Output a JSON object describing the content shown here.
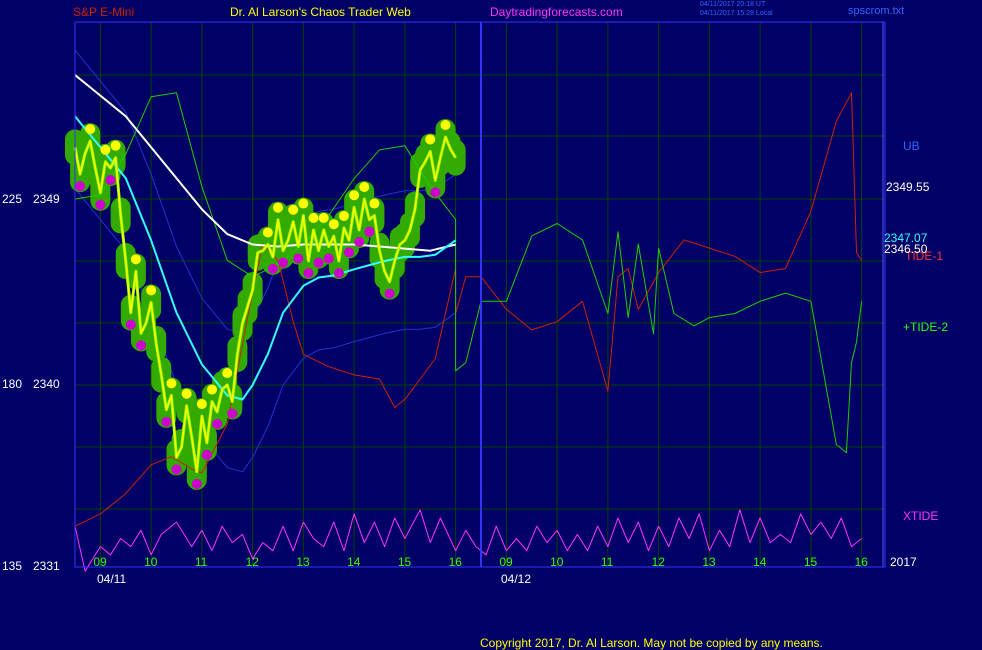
{
  "header": {
    "symbol": "S&P E-Mini",
    "site_title": "Dr. Al Larson's Chaos Trader Web",
    "site_url": "Daytradingforecasts.com",
    "timestamp_utc": "04/11/2017 20:18 UT",
    "timestamp_local": "04/11/2017 15:28 Local",
    "file": "spscrom.txt"
  },
  "footer": {
    "copyright": "Copyright 2017, Dr. Al Larson. May not be copied by any means."
  },
  "colors": {
    "background": "#000066",
    "grid": "#004400",
    "frame": "#3333ff",
    "price": "#ffff00",
    "average": "#ffffff",
    "cyan_average": "#33ffff",
    "bands": "#2233cc",
    "tide1": "#cc2200",
    "tide2": "#22cc00",
    "xtide": "#ff33ff",
    "blob": "#33aa00",
    "hit_high": "#ffff00",
    "hit_low": "#cc00cc"
  },
  "chart_data": {
    "type": "line",
    "title": "S&P E-Mini",
    "left_axis_ticks": [
      {
        "osc": "225",
        "price": "2349"
      },
      {
        "osc": "180",
        "price": "2340"
      },
      {
        "osc": "135",
        "price": "2331"
      }
    ],
    "x_hour_labels_day1": [
      "09",
      "10",
      "11",
      "12",
      "13",
      "14",
      "15",
      "16"
    ],
    "x_hour_labels_day2": [
      "09",
      "10",
      "11",
      "12",
      "13",
      "14",
      "15",
      "16"
    ],
    "dates": [
      "04/11",
      "04/12"
    ],
    "year": "2017",
    "price_ylim": [
      2331,
      2355
    ],
    "x_range_hours": [
      8.5,
      16.5
    ],
    "price_series": {
      "name": "S&P E-Mini",
      "x": [
        8.5,
        8.6,
        8.7,
        8.8,
        8.9,
        9.0,
        9.1,
        9.2,
        9.3,
        9.4,
        9.5,
        9.6,
        9.7,
        9.8,
        9.9,
        10.0,
        10.1,
        10.2,
        10.3,
        10.4,
        10.5,
        10.6,
        10.7,
        10.8,
        10.9,
        11.0,
        11.1,
        11.2,
        11.3,
        11.4,
        11.5,
        11.6,
        11.7,
        11.8,
        11.9,
        12.0,
        12.1,
        12.2,
        12.3,
        12.4,
        12.5,
        12.6,
        12.7,
        12.8,
        12.9,
        13.0,
        13.1,
        13.2,
        13.3,
        13.4,
        13.5,
        13.6,
        13.7,
        13.8,
        13.9,
        14.0,
        14.1,
        14.2,
        14.3,
        14.4,
        14.5,
        14.6,
        14.7,
        14.8,
        14.9,
        15.0,
        15.1,
        15.2,
        15.3,
        15.4,
        15.5,
        15.6,
        15.7,
        15.8,
        15.9,
        16.0
      ],
      "y": [
        2351.5,
        2350.2,
        2351.2,
        2351.8,
        2350.5,
        2349.3,
        2350.8,
        2350.5,
        2351.0,
        2348.2,
        2346.0,
        2343.5,
        2345.5,
        2342.5,
        2343.0,
        2344.0,
        2342.0,
        2340.5,
        2338.8,
        2339.5,
        2336.5,
        2337.0,
        2339.0,
        2337.5,
        2335.8,
        2338.5,
        2337.2,
        2339.2,
        2338.7,
        2339.8,
        2340.0,
        2339.2,
        2341.5,
        2343.0,
        2343.8,
        2344.6,
        2346.4,
        2346.5,
        2346.8,
        2346.2,
        2348.0,
        2346.5,
        2347.0,
        2347.9,
        2346.7,
        2348.2,
        2346.0,
        2347.5,
        2346.5,
        2347.5,
        2346.7,
        2347.2,
        2346.0,
        2347.6,
        2347.0,
        2348.6,
        2347.5,
        2349.0,
        2348.0,
        2348.2,
        2346.5,
        2345.5,
        2345.0,
        2346.0,
        2346.8,
        2347.0,
        2347.5,
        2348.5,
        2350.4,
        2350.8,
        2351.3,
        2349.9,
        2351.0,
        2352.0,
        2351.4,
        2351.0
      ]
    },
    "white_average": {
      "x": [
        8.5,
        9.0,
        9.5,
        10.0,
        10.5,
        11.0,
        11.5,
        12.0,
        12.5,
        13.0,
        13.5,
        14.0,
        14.5,
        15.0,
        15.5,
        16.0
      ],
      "y": [
        2355.0,
        2354.0,
        2353.0,
        2351.5,
        2350.0,
        2348.5,
        2347.3,
        2346.8,
        2346.7,
        2346.8,
        2346.8,
        2346.8,
        2346.7,
        2346.6,
        2346.5,
        2346.8
      ]
    },
    "cyan_average": {
      "x": [
        8.5,
        9.0,
        9.5,
        10.0,
        10.5,
        11.0,
        11.5,
        11.8,
        12.0,
        12.3,
        12.6,
        13.0,
        13.3,
        13.6,
        14.0,
        14.3,
        14.6,
        15.0,
        15.3,
        15.6,
        16.0
      ],
      "y": [
        2353.0,
        2351.5,
        2350.0,
        2347.0,
        2343.5,
        2341.0,
        2339.5,
        2339.3,
        2340.0,
        2341.5,
        2343.5,
        2344.8,
        2345.2,
        2345.3,
        2345.6,
        2345.8,
        2346.0,
        2346.2,
        2346.2,
        2346.3,
        2347.0
      ]
    },
    "tide_series": [
      {
        "name": "TIDE-1",
        "end_value": "2346.50",
        "x": [
          8.5,
          9.0,
          9.5,
          10.0,
          10.4,
          10.8,
          11.0,
          11.5,
          11.9,
          12.2,
          12.5,
          12.8,
          13.0,
          13.5,
          14.0,
          14.5,
          14.8,
          15.0,
          15.3,
          15.6,
          16.0,
          16.0,
          16.2,
          16.5,
          17.0,
          17.5,
          18.0,
          18.5,
          19.0,
          19.2,
          19.4,
          19.6,
          20.0,
          20.5,
          21.0,
          21.5,
          22.0,
          22.5,
          23.0,
          23.5,
          23.8,
          23.9,
          24.0
        ],
        "y": [
          145,
          148,
          153,
          160,
          162,
          159,
          158,
          170,
          196,
          214,
          210,
          195,
          187,
          184,
          182,
          181,
          174,
          176,
          181,
          186,
          208,
          197,
          206,
          206,
          198,
          193,
          195,
          200,
          178,
          206,
          208,
          198,
          207,
          215,
          213,
          211,
          207,
          208,
          222,
          244,
          251,
          212,
          210
        ]
      },
      {
        "name": "+TIDE-2",
        "end_value": "",
        "x": [
          8.5,
          9.0,
          9.5,
          10.0,
          10.5,
          11.0,
          11.5,
          12.0,
          12.5,
          13.0,
          13.5,
          14.0,
          14.5,
          15.0,
          15.5,
          16.0,
          16.0,
          16.2,
          16.5,
          17.0,
          17.5,
          18.0,
          18.5,
          19.0,
          19.2,
          19.4,
          19.6,
          19.9,
          20.0,
          20.3,
          20.7,
          21.0,
          21.5,
          22.0,
          22.5,
          23.0,
          23.5,
          23.7,
          23.8,
          23.9,
          24.0
        ],
        "y": [
          225,
          226,
          236,
          250,
          251,
          228,
          210,
          206,
          209,
          214,
          221,
          230,
          237,
          238,
          228,
          220,
          183,
          185,
          200,
          200,
          216,
          219,
          215,
          197,
          217,
          196,
          214,
          192,
          213,
          197,
          194,
          196,
          197,
          200,
          202,
          200,
          165,
          163,
          185,
          190,
          200
        ]
      }
    ],
    "xtide_series": {
      "name": "XTIDE",
      "x": [
        8.5,
        8.7,
        9.0,
        9.2,
        9.4,
        9.6,
        9.8,
        10.0,
        10.2,
        10.5,
        10.8,
        11.0,
        11.2,
        11.4,
        11.6,
        11.8,
        12.0,
        12.2,
        12.4,
        12.6,
        12.8,
        13.0,
        13.2,
        13.4,
        13.6,
        13.8,
        14.0,
        14.2,
        14.4,
        14.6,
        14.8,
        15.0,
        15.3,
        15.5,
        15.7,
        16.0,
        16.2,
        16.4,
        16.6,
        16.8,
        17.0,
        17.2,
        17.4,
        17.6,
        17.8,
        18.0,
        18.2,
        18.4,
        18.6,
        18.8,
        19.0,
        19.2,
        19.4,
        19.6,
        19.8,
        20.0,
        20.2,
        20.4,
        20.6,
        20.8,
        21.0,
        21.2,
        21.4,
        21.6,
        21.8,
        22.0,
        22.2,
        22.4,
        22.6,
        22.8,
        23.0,
        23.2,
        23.4,
        23.6,
        23.8,
        24.0
      ],
      "y": [
        145,
        134,
        140,
        138,
        142,
        140,
        144,
        138,
        143,
        146,
        140,
        144,
        139,
        145,
        141,
        143,
        137,
        141,
        139,
        145,
        139,
        146,
        142,
        140,
        146,
        139,
        148,
        141,
        146,
        140,
        147,
        142,
        149,
        141,
        147,
        139,
        144,
        140,
        138,
        145,
        139,
        142,
        139,
        145,
        141,
        144,
        139,
        143,
        139,
        145,
        140,
        147,
        141,
        146,
        139,
        145,
        140,
        147,
        142,
        148,
        139,
        144,
        140,
        149,
        141,
        147,
        141,
        143,
        141,
        148,
        143,
        146,
        142,
        147,
        140,
        142
      ]
    }
  },
  "right_labels": {
    "ub": "UB",
    "price_ub": "2349.55",
    "price_cyan": "2347.07",
    "price_white": "2346.50",
    "tide1": "TIDE-1",
    "tide2": "+TIDE-2",
    "xtide": "XTIDE"
  }
}
